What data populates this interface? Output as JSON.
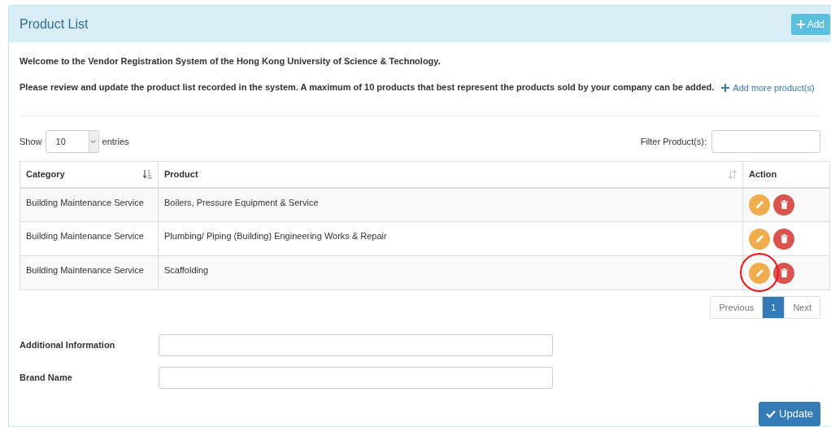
{
  "panel": {
    "title": "Product List",
    "add_button": "Add"
  },
  "intro": [
    "Welcome to the Vendor Registration System of the Hong Kong University of Science & Technology.",
    "Please review and update the product list recorded in the system. A maximum of 10 products that best represent the products sold by your company can be added."
  ],
  "add_more_link": "Add more product(s)",
  "length_control": {
    "show": "Show",
    "value": "10",
    "entries": "entries"
  },
  "filter": {
    "label": "Filter Product(s):"
  },
  "table": {
    "columns": [
      "Category",
      "Product",
      "Action"
    ],
    "rows": [
      {
        "category": "Building Maintenance Service",
        "product": "Boilers, Pressure Equipment & Service",
        "circled": false
      },
      {
        "category": "Building Maintenance Service",
        "product": "Plumbing/ Piping (Building) Engineering Works & Repair",
        "circled": false
      },
      {
        "category": "Building Maintenance Service",
        "product": "Scaffolding",
        "circled": true
      }
    ]
  },
  "pagination": [
    {
      "label": "Previous",
      "selected": false
    },
    {
      "label": "1",
      "selected": true
    },
    {
      "label": "Next",
      "selected": false
    }
  ],
  "fields": [
    {
      "label": "Additional Information"
    },
    {
      "label": "Brand Name"
    }
  ],
  "update_button": "Update"
}
